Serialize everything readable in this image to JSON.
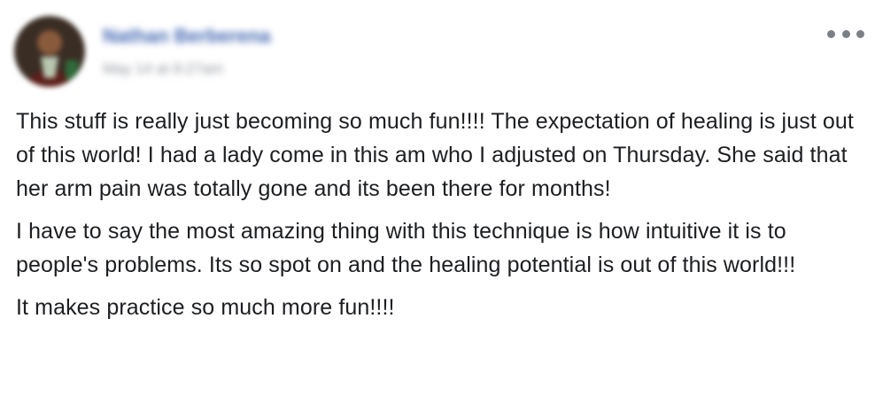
{
  "post": {
    "author_name": "Nathan Berberena",
    "timestamp": "May 14 at 8:27am",
    "more_icon": "ellipsis-horizontal-icon",
    "paragraphs": [
      "This stuff is really just becoming so much fun!!!! The expectation of healing is just out of this world! I had a lady come in this am who I adjusted on Thursday. She said that her arm pain was totally gone and its been there for months!",
      "I have to say the most amazing thing with this technique is how intuitive it is to people's problems. Its so spot on and the healing potential is out of this world!!!",
      "It makes practice so much more fun!!!!"
    ]
  },
  "colors": {
    "author_link": "#4267b2",
    "timestamp": "#90949c",
    "body_text": "#1c1e21",
    "more_dots": "#7b7f86"
  }
}
